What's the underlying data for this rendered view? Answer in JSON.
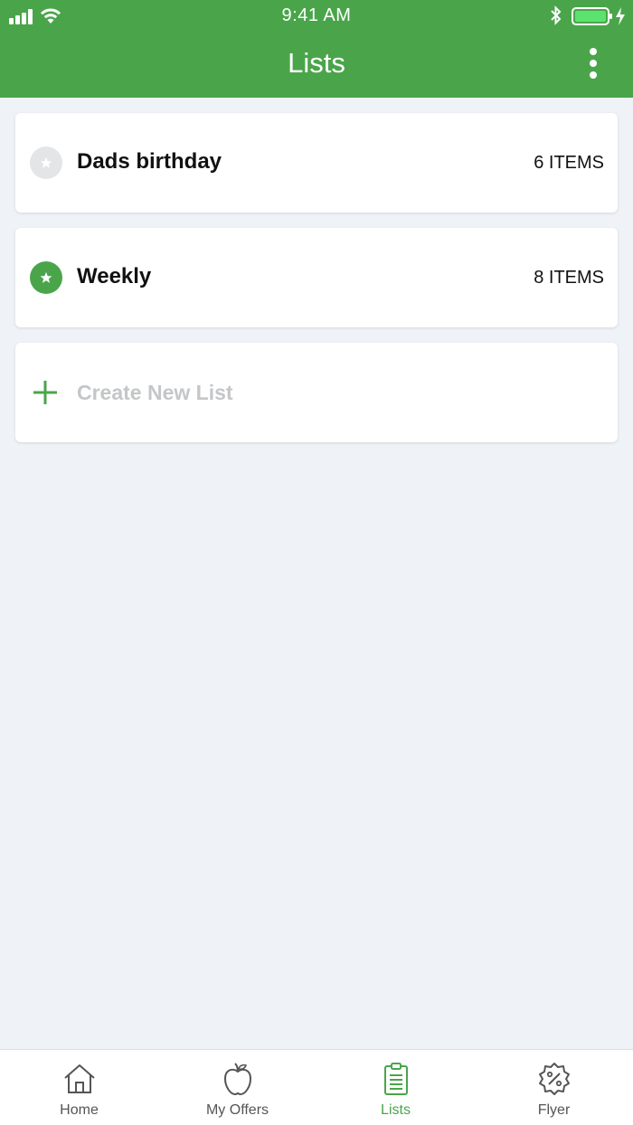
{
  "status": {
    "time": "9:41 AM"
  },
  "header": {
    "title": "Lists"
  },
  "lists": [
    {
      "name": "Dads birthday",
      "count": "6 ITEMS",
      "favorite": false
    },
    {
      "name": "Weekly",
      "count": "8 ITEMS",
      "favorite": true
    }
  ],
  "create": {
    "label": "Create New List"
  },
  "tabs": [
    {
      "label": "Home",
      "icon": "home-icon"
    },
    {
      "label": "My Offers",
      "icon": "apple-icon"
    },
    {
      "label": "Lists",
      "icon": "clipboard-icon",
      "active": true
    },
    {
      "label": "Flyer",
      "icon": "percent-badge-icon"
    }
  ],
  "colors": {
    "brand": "#4aa54a",
    "background": "#eff3f7",
    "inactive_star": "#e3e5e7",
    "placeholder": "#c4c6c8"
  }
}
